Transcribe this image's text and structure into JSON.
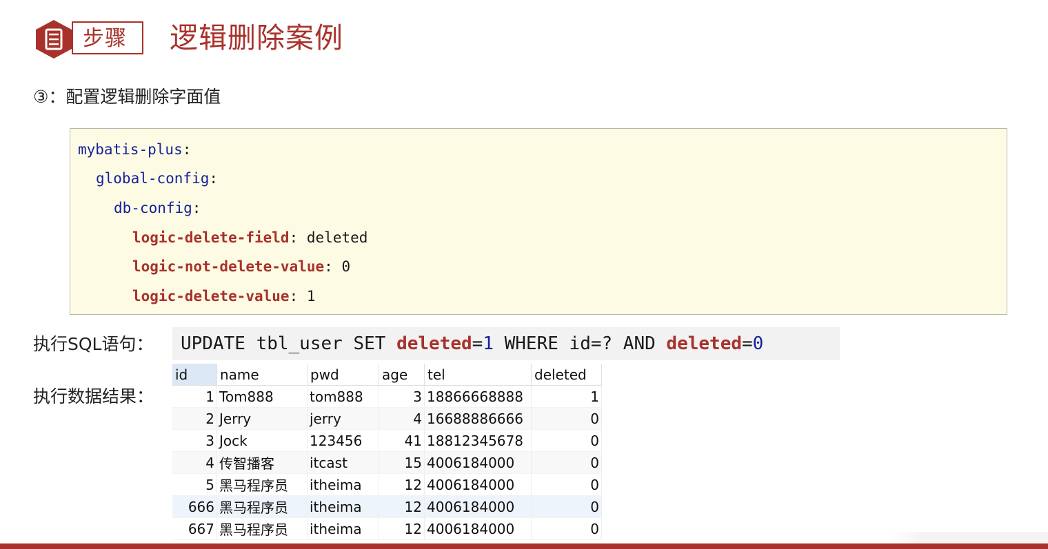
{
  "header": {
    "step_label": "步骤",
    "title": "逻辑删除案例"
  },
  "subtitle": "③：配置逻辑删除字面值",
  "yaml": {
    "line1_key": "mybatis-plus",
    "line2_key": "global-config",
    "line3_key": "db-config",
    "line4_key": "logic-delete-field",
    "line4_value": "deleted",
    "line5_key": "logic-not-delete-value",
    "line5_value": "0",
    "line6_key": "logic-delete-value",
    "line6_value": "1",
    "separator": ":"
  },
  "sql": {
    "label": "执行SQL语句：",
    "part1": "UPDATE tbl_user SET ",
    "part2": "deleted",
    "part3": "=",
    "part4": "1",
    "part5": " WHERE id=? AND ",
    "part6": "deleted",
    "part7": "=",
    "part8": "0"
  },
  "result": {
    "label": "执行数据结果：",
    "columns": [
      "id",
      "name",
      "pwd",
      "age",
      "tel",
      "deleted"
    ],
    "rows": [
      [
        "1",
        "Tom888",
        "tom888",
        "3",
        "18866668888",
        "1"
      ],
      [
        "2",
        "Jerry",
        "jerry",
        "4",
        "16688886666",
        "0"
      ],
      [
        "3",
        "Jock",
        "123456",
        "41",
        "18812345678",
        "0"
      ],
      [
        "4",
        "传智播客",
        "itcast",
        "15",
        "4006184000",
        "0"
      ],
      [
        "5",
        "黑马程序员",
        "itheima",
        "12",
        "4006184000",
        "0"
      ],
      [
        "666",
        "黑马程序员",
        "itheima",
        "12",
        "4006184000",
        "0"
      ],
      [
        "667",
        "黑马程序员",
        "itheima",
        "12",
        "4006184000",
        "0"
      ]
    ],
    "selected_row": 5
  },
  "colors": {
    "accent": "#a8322b",
    "code_keyword": "#15219b",
    "code_background": "#fdfbe4"
  },
  "icons": {
    "step": "document-icon"
  }
}
